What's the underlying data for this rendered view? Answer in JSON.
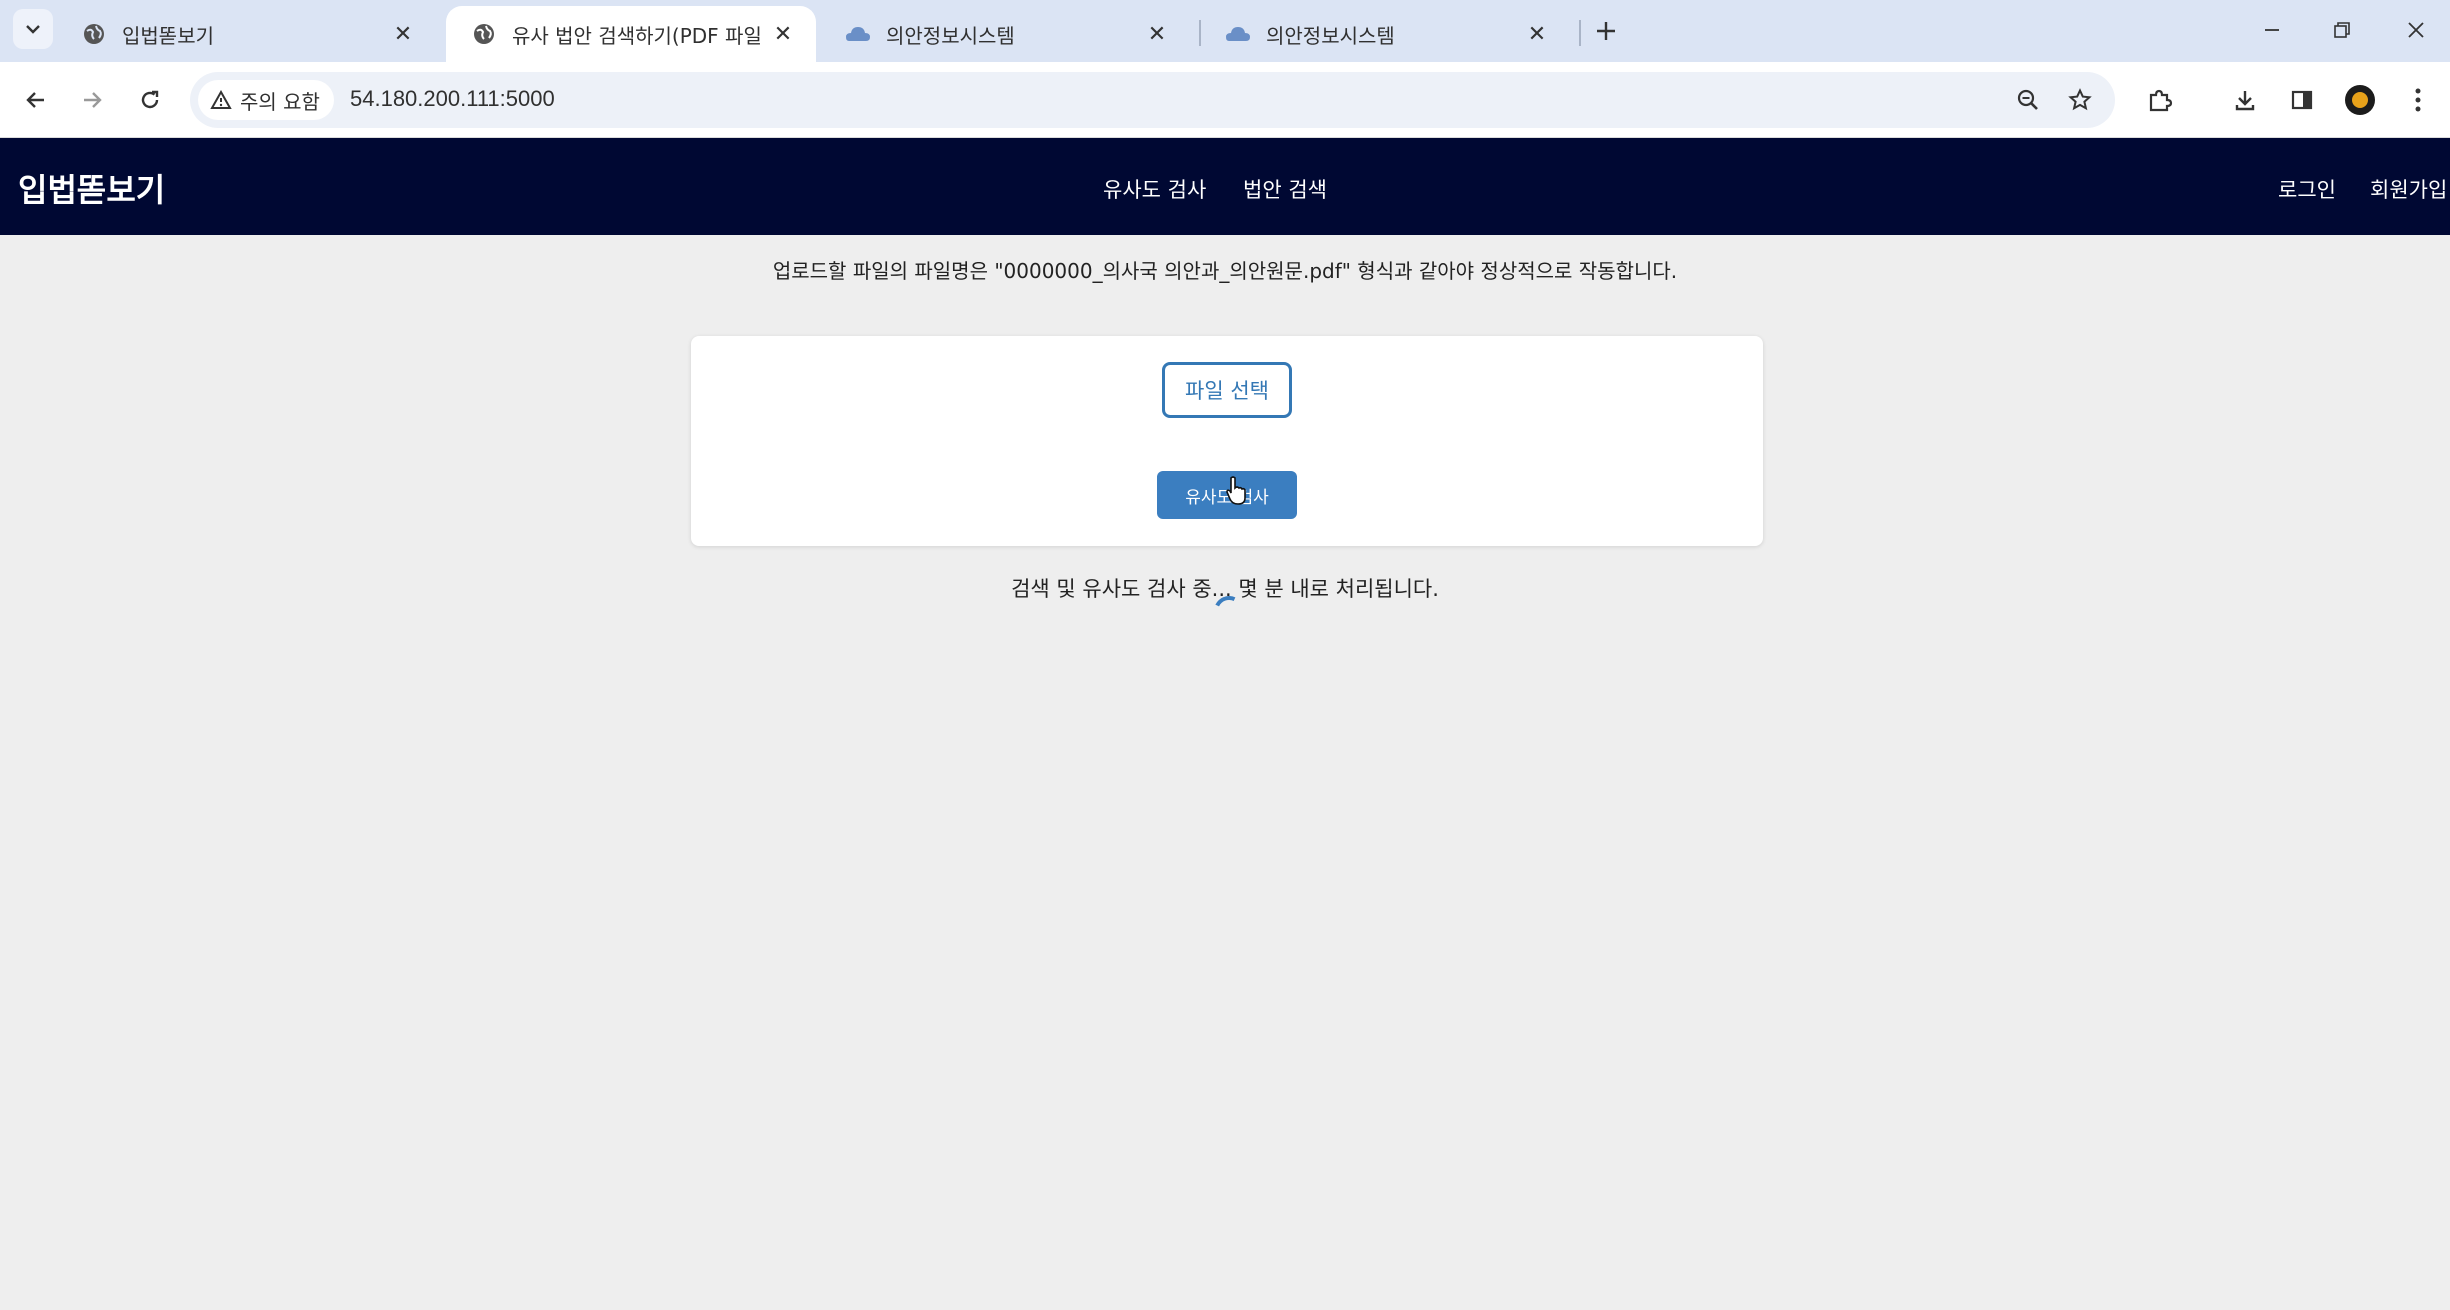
{
  "browser": {
    "tabs": [
      {
        "title": "입법똗보기",
        "icon": "globe-icon",
        "active": false
      },
      {
        "title": "유사 법안 검색하기(PDF 파일 업로드)",
        "icon": "globe-icon",
        "active": true
      },
      {
        "title": "의안정보시스템",
        "icon": "cloud-icon",
        "active": false
      },
      {
        "title": "의안정보시스템",
        "icon": "cloud-icon",
        "active": false
      }
    ],
    "security_label": "주의 요함",
    "url": "54.180.200.111:5000"
  },
  "header": {
    "brand": "입법똗보기",
    "nav": {
      "similarity": "유사도 검사",
      "bill_search": "법안 검색",
      "login": "로그인",
      "signup": "회원가입"
    },
    "background": "#000833"
  },
  "main": {
    "notice": "업로드할 파일의 파일명은 \"0000000_의사국 의안과_의안원문.pdf\" 형식과 같아야 정상적으로 작동합니다.",
    "file_button": "파일 선택",
    "check_button": "유사도 검사",
    "status": "검색 및 유사도 검사 중... 몇 분 내로 처리됩니다.",
    "accent": "#3b7ec0"
  }
}
